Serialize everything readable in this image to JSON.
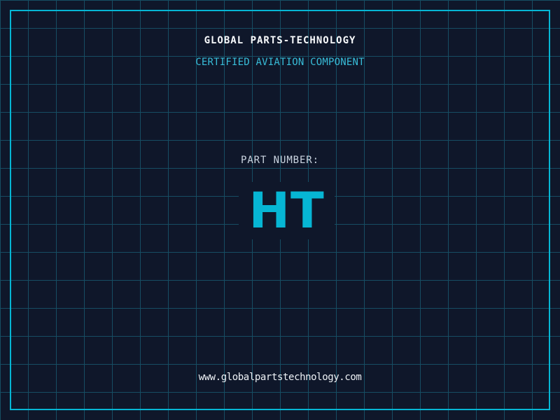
{
  "page": {
    "background_color": "#0f172a",
    "grid_color": "#164e63",
    "grid_spacing_px": 40,
    "frame_color": "#06b6d4"
  },
  "header": {
    "title": "GLOBAL PARTS-TECHNOLOGY",
    "title_color": "#f8fafc",
    "subtitle": "CERTIFIED AVIATION COMPONENT",
    "subtitle_color": "#38bdd9"
  },
  "part": {
    "label": "PART NUMBER:",
    "label_color": "#cbd5e1",
    "value": "HT",
    "value_color": "#06b6d4"
  },
  "footer": {
    "website": "www.globalpartstechnology.com",
    "website_color": "#eef2f6"
  }
}
